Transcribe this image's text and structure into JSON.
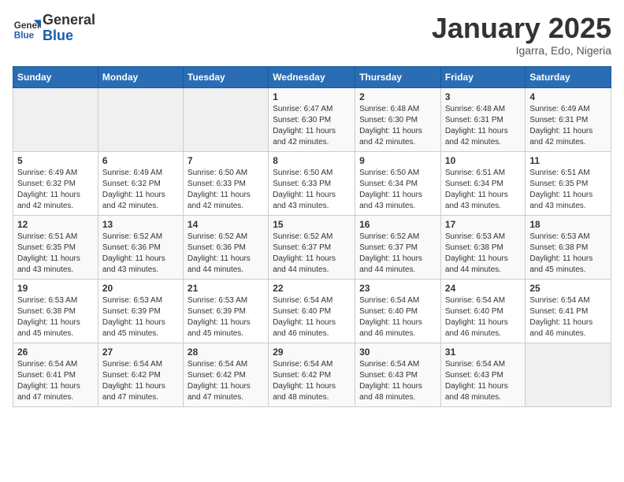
{
  "header": {
    "logo_general": "General",
    "logo_blue": "Blue",
    "month_title": "January 2025",
    "subtitle": "Igarra, Edo, Nigeria"
  },
  "days_of_week": [
    "Sunday",
    "Monday",
    "Tuesday",
    "Wednesday",
    "Thursday",
    "Friday",
    "Saturday"
  ],
  "weeks": [
    [
      {
        "day": "",
        "info": ""
      },
      {
        "day": "",
        "info": ""
      },
      {
        "day": "",
        "info": ""
      },
      {
        "day": "1",
        "info": "Sunrise: 6:47 AM\nSunset: 6:30 PM\nDaylight: 11 hours and 42 minutes."
      },
      {
        "day": "2",
        "info": "Sunrise: 6:48 AM\nSunset: 6:30 PM\nDaylight: 11 hours and 42 minutes."
      },
      {
        "day": "3",
        "info": "Sunrise: 6:48 AM\nSunset: 6:31 PM\nDaylight: 11 hours and 42 minutes."
      },
      {
        "day": "4",
        "info": "Sunrise: 6:49 AM\nSunset: 6:31 PM\nDaylight: 11 hours and 42 minutes."
      }
    ],
    [
      {
        "day": "5",
        "info": "Sunrise: 6:49 AM\nSunset: 6:32 PM\nDaylight: 11 hours and 42 minutes."
      },
      {
        "day": "6",
        "info": "Sunrise: 6:49 AM\nSunset: 6:32 PM\nDaylight: 11 hours and 42 minutes."
      },
      {
        "day": "7",
        "info": "Sunrise: 6:50 AM\nSunset: 6:33 PM\nDaylight: 11 hours and 42 minutes."
      },
      {
        "day": "8",
        "info": "Sunrise: 6:50 AM\nSunset: 6:33 PM\nDaylight: 11 hours and 43 minutes."
      },
      {
        "day": "9",
        "info": "Sunrise: 6:50 AM\nSunset: 6:34 PM\nDaylight: 11 hours and 43 minutes."
      },
      {
        "day": "10",
        "info": "Sunrise: 6:51 AM\nSunset: 6:34 PM\nDaylight: 11 hours and 43 minutes."
      },
      {
        "day": "11",
        "info": "Sunrise: 6:51 AM\nSunset: 6:35 PM\nDaylight: 11 hours and 43 minutes."
      }
    ],
    [
      {
        "day": "12",
        "info": "Sunrise: 6:51 AM\nSunset: 6:35 PM\nDaylight: 11 hours and 43 minutes."
      },
      {
        "day": "13",
        "info": "Sunrise: 6:52 AM\nSunset: 6:36 PM\nDaylight: 11 hours and 43 minutes."
      },
      {
        "day": "14",
        "info": "Sunrise: 6:52 AM\nSunset: 6:36 PM\nDaylight: 11 hours and 44 minutes."
      },
      {
        "day": "15",
        "info": "Sunrise: 6:52 AM\nSunset: 6:37 PM\nDaylight: 11 hours and 44 minutes."
      },
      {
        "day": "16",
        "info": "Sunrise: 6:52 AM\nSunset: 6:37 PM\nDaylight: 11 hours and 44 minutes."
      },
      {
        "day": "17",
        "info": "Sunrise: 6:53 AM\nSunset: 6:38 PM\nDaylight: 11 hours and 44 minutes."
      },
      {
        "day": "18",
        "info": "Sunrise: 6:53 AM\nSunset: 6:38 PM\nDaylight: 11 hours and 45 minutes."
      }
    ],
    [
      {
        "day": "19",
        "info": "Sunrise: 6:53 AM\nSunset: 6:38 PM\nDaylight: 11 hours and 45 minutes."
      },
      {
        "day": "20",
        "info": "Sunrise: 6:53 AM\nSunset: 6:39 PM\nDaylight: 11 hours and 45 minutes."
      },
      {
        "day": "21",
        "info": "Sunrise: 6:53 AM\nSunset: 6:39 PM\nDaylight: 11 hours and 45 minutes."
      },
      {
        "day": "22",
        "info": "Sunrise: 6:54 AM\nSunset: 6:40 PM\nDaylight: 11 hours and 46 minutes."
      },
      {
        "day": "23",
        "info": "Sunrise: 6:54 AM\nSunset: 6:40 PM\nDaylight: 11 hours and 46 minutes."
      },
      {
        "day": "24",
        "info": "Sunrise: 6:54 AM\nSunset: 6:40 PM\nDaylight: 11 hours and 46 minutes."
      },
      {
        "day": "25",
        "info": "Sunrise: 6:54 AM\nSunset: 6:41 PM\nDaylight: 11 hours and 46 minutes."
      }
    ],
    [
      {
        "day": "26",
        "info": "Sunrise: 6:54 AM\nSunset: 6:41 PM\nDaylight: 11 hours and 47 minutes."
      },
      {
        "day": "27",
        "info": "Sunrise: 6:54 AM\nSunset: 6:42 PM\nDaylight: 11 hours and 47 minutes."
      },
      {
        "day": "28",
        "info": "Sunrise: 6:54 AM\nSunset: 6:42 PM\nDaylight: 11 hours and 47 minutes."
      },
      {
        "day": "29",
        "info": "Sunrise: 6:54 AM\nSunset: 6:42 PM\nDaylight: 11 hours and 48 minutes."
      },
      {
        "day": "30",
        "info": "Sunrise: 6:54 AM\nSunset: 6:43 PM\nDaylight: 11 hours and 48 minutes."
      },
      {
        "day": "31",
        "info": "Sunrise: 6:54 AM\nSunset: 6:43 PM\nDaylight: 11 hours and 48 minutes."
      },
      {
        "day": "",
        "info": ""
      }
    ]
  ]
}
